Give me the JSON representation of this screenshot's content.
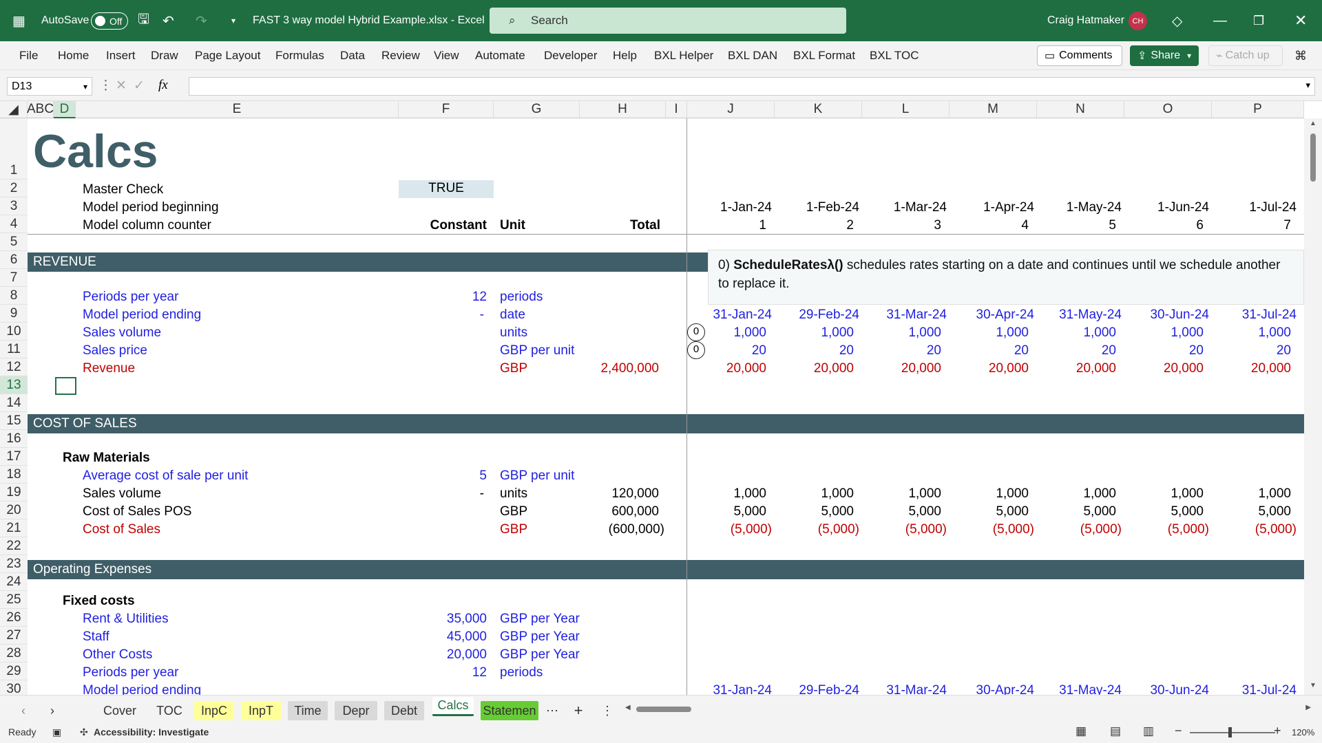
{
  "titlebar": {
    "autosave_label": "AutoSave",
    "autosave_state": "Off",
    "filename": "FAST 3 way model Hybrid Example.xlsx  -  Excel",
    "search_placeholder": "Search",
    "user_name": "Craig Hatmaker",
    "user_initials": "CH",
    "accent": "#1e6e42"
  },
  "ribbon": {
    "tabs": [
      "File",
      "Home",
      "Insert",
      "Draw",
      "Page Layout",
      "Formulas",
      "Data",
      "Review",
      "View",
      "Automate",
      "Developer",
      "Help",
      "BXL Helper",
      "BXL DAN",
      "BXL Format",
      "BXL TOC"
    ],
    "comments": "Comments",
    "share": "Share",
    "catch_up": "Catch up"
  },
  "formula_bar": {
    "name_box": "D13",
    "fx": "fx",
    "formula": ""
  },
  "columns": [
    "ABC",
    "D",
    "E",
    "F",
    "G",
    "H",
    "I",
    "J",
    "K",
    "L",
    "M",
    "N",
    "O",
    "P"
  ],
  "rows": [
    "1",
    "2",
    "3",
    "4",
    "5",
    "6",
    "7",
    "8",
    "9",
    "10",
    "11",
    "12",
    "13",
    "14",
    "15",
    "16",
    "17",
    "18",
    "19",
    "20",
    "21",
    "22",
    "23",
    "24",
    "25",
    "26",
    "27",
    "28",
    "29",
    "30"
  ],
  "sheet": {
    "title": "Calcs",
    "master_check_label": "Master Check",
    "master_check_value": "TRUE",
    "model_period_beginning": "Model period beginning",
    "model_column_counter": "Model column counter",
    "hdr_constant": "Constant",
    "hdr_unit": "Unit",
    "hdr_total": "Total",
    "dates": [
      "1-Jan-24",
      "1-Feb-24",
      "1-Mar-24",
      "1-Apr-24",
      "1-May-24",
      "1-Jun-24",
      "1-Jul-24"
    ],
    "counters": [
      "1",
      "2",
      "3",
      "4",
      "5",
      "6",
      "7"
    ],
    "end_dates": [
      "31-Jan-24",
      "29-Feb-24",
      "31-Mar-24",
      "30-Apr-24",
      "31-May-24",
      "30-Jun-24",
      "31-Jul-24"
    ],
    "revenue_banner": "REVENUE",
    "periods_per_year": {
      "label": "Periods per year",
      "constant": "12",
      "unit": "periods"
    },
    "model_period_ending": {
      "label": "Model period ending",
      "constant": "-",
      "unit": "date"
    },
    "sales_volume": {
      "label": "Sales volume",
      "unit": "units",
      "values": [
        "1,000",
        "1,000",
        "1,000",
        "1,000",
        "1,000",
        "1,000",
        "1,000"
      ],
      "marker": "0"
    },
    "sales_price": {
      "label": "Sales price",
      "unit": "GBP per unit",
      "values": [
        "20",
        "20",
        "20",
        "20",
        "20",
        "20",
        "20"
      ],
      "marker": "0"
    },
    "revenue": {
      "label": "Revenue",
      "unit": "GBP",
      "total": "2,400,000",
      "values": [
        "20,000",
        "20,000",
        "20,000",
        "20,000",
        "20,000",
        "20,000",
        "20,000"
      ]
    },
    "cos_banner": "COST OF SALES",
    "raw_materials": "Raw Materials",
    "avg_cost": {
      "label": "Average cost of sale per unit",
      "constant": "5",
      "unit": "GBP per unit"
    },
    "cos_sales_volume": {
      "label": "Sales volume",
      "constant": "-",
      "unit": "units",
      "total": "120,000",
      "values": [
        "1,000",
        "1,000",
        "1,000",
        "1,000",
        "1,000",
        "1,000",
        "1,000"
      ]
    },
    "cos_pos": {
      "label": "Cost of Sales POS",
      "unit": "GBP",
      "total": "600,000",
      "values": [
        "5,000",
        "5,000",
        "5,000",
        "5,000",
        "5,000",
        "5,000",
        "5,000"
      ]
    },
    "cos": {
      "label": "Cost of Sales",
      "unit": "GBP",
      "total": "(600,000)",
      "values": [
        "(5,000)",
        "(5,000)",
        "(5,000)",
        "(5,000)",
        "(5,000)",
        "(5,000)",
        "(5,000)"
      ]
    },
    "opex_banner": "Operating Expenses",
    "fixed_costs": "Fixed costs",
    "rent": {
      "label": "Rent & Utilities",
      "constant": "35,000",
      "unit": "GBP per Year"
    },
    "staff": {
      "label": "Staff",
      "constant": "45,000",
      "unit": "GBP per Year"
    },
    "other": {
      "label": "Other Costs",
      "constant": "20,000",
      "unit": "GBP per Year"
    },
    "opex_periods": {
      "label": "Periods per year",
      "constant": "12",
      "unit": "periods"
    },
    "opex_period_ending": {
      "label": "Model period ending"
    }
  },
  "tooltip": {
    "prefix": "0) ",
    "func": "ScheduleRatesλ()",
    "text": " schedules rates starting on a date and continues until we schedule another to replace it."
  },
  "sheet_tabs": [
    "Cover",
    "TOC",
    "InpC",
    "InpT",
    "Time",
    "Depr",
    "Debt",
    "Calcs",
    "Statemen"
  ],
  "status": {
    "ready": "Ready",
    "accessibility": "Accessibility: Investigate",
    "zoom": "120%"
  },
  "colors": {
    "input_blue": "#1f1fe0",
    "output_red": "#c00000",
    "banner": "#3f5e68",
    "inpc_tab": "#ffff99",
    "statements_tab": "#66cc33"
  }
}
